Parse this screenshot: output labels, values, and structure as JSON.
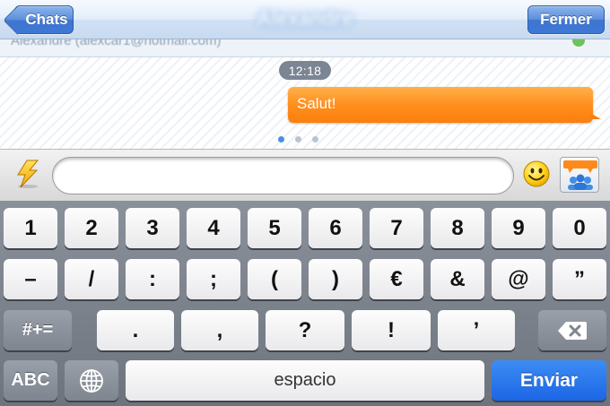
{
  "navbar": {
    "back_label": "Chats",
    "title": "Alexandre",
    "close_label": "Fermer"
  },
  "contact": {
    "line": "Alexandre  (alexcar1@hotmail.com)"
  },
  "chat": {
    "timestamp": "12:18",
    "messages": [
      {
        "text": "Salut!",
        "from": "me"
      }
    ],
    "page_indicator": {
      "count": 3,
      "active": 1
    }
  },
  "input_bar": {
    "value": "",
    "icons": [
      "flash-icon",
      "smiley-icon",
      "group-chat-icon"
    ]
  },
  "keyboard": {
    "row1": [
      "1",
      "2",
      "3",
      "4",
      "5",
      "6",
      "7",
      "8",
      "9",
      "0"
    ],
    "row2": [
      "–",
      "/",
      ":",
      ";",
      "(",
      ")",
      "€",
      "&",
      "@",
      "”"
    ],
    "row3_left": "#+=",
    "row3": [
      ".",
      ",",
      "?",
      "!",
      "’"
    ],
    "abc_label": "ABC",
    "space_label": "espacio",
    "send_label": "Enviar"
  },
  "colors": {
    "bubble": "#fb8c18",
    "nav_button": "#4a7fd6",
    "send_key": "#1c66e4"
  }
}
